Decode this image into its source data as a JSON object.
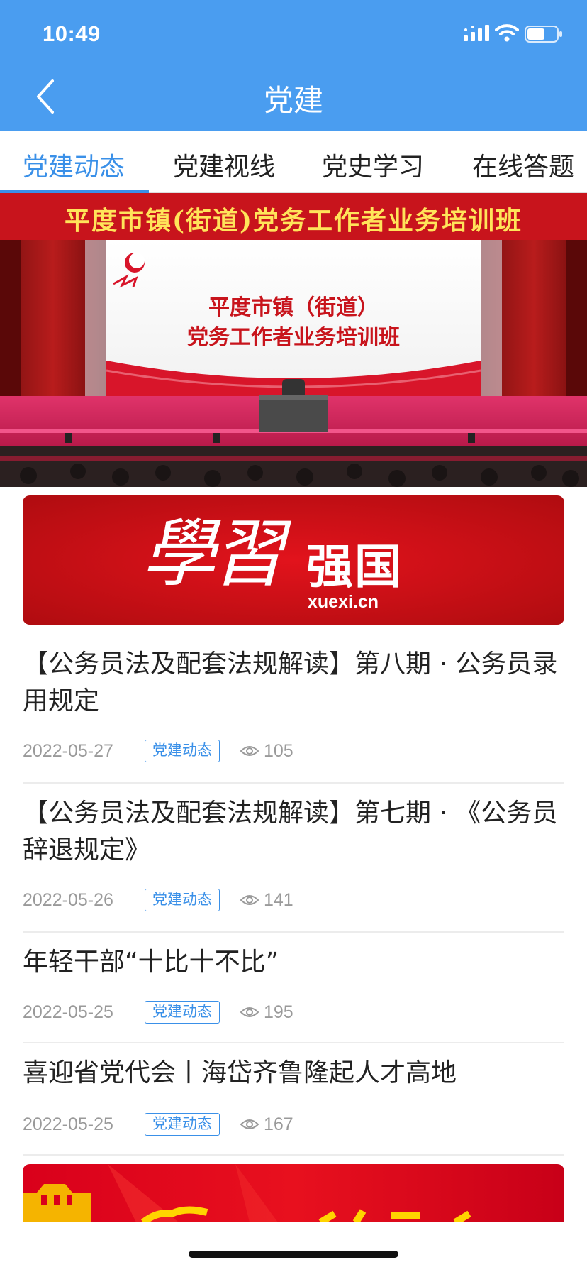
{
  "status_bar": {
    "time": "10:49"
  },
  "header": {
    "title": "党建"
  },
  "tabs": [
    {
      "label": "党建动态",
      "active": true
    },
    {
      "label": "党建视线",
      "active": false
    },
    {
      "label": "党史学习",
      "active": false
    },
    {
      "label": "在线答题",
      "active": false
    }
  ],
  "hero": {
    "banner_text": "平度市镇(街道)党务工作者业务培训班",
    "screen_line1": "平度市镇（街道）",
    "screen_line2": "党务工作者业务培训班"
  },
  "xuexi_banner": {
    "calligraphy": "學習",
    "brand": "强国",
    "domain": "xuexi.cn"
  },
  "news": [
    {
      "title": "【公务员法及配套法规解读】第八期 · 公务员录用规定",
      "date": "2022-05-27",
      "tag": "党建动态",
      "views": "105"
    },
    {
      "title": "【公务员法及配套法规解读】第七期 · 《公务员辞退规定》",
      "date": "2022-05-26",
      "tag": "党建动态",
      "views": "141"
    },
    {
      "title": "年轻干部“十比十不比”",
      "date": "2022-05-25",
      "tag": "党建动态",
      "views": "195"
    },
    {
      "title": "喜迎省党代会丨海岱齐鲁隆起人才高地",
      "date": "2022-05-25",
      "tag": "党建动态",
      "views": "167"
    }
  ],
  "icons": {
    "back": "chevron-left-icon",
    "signal": "signal-icon",
    "wifi": "wifi-icon",
    "battery": "battery-icon",
    "views": "eye-icon"
  },
  "colors": {
    "header": "#4a9df0",
    "accent": "#3a90e8",
    "banner_red": "#d9001b"
  }
}
